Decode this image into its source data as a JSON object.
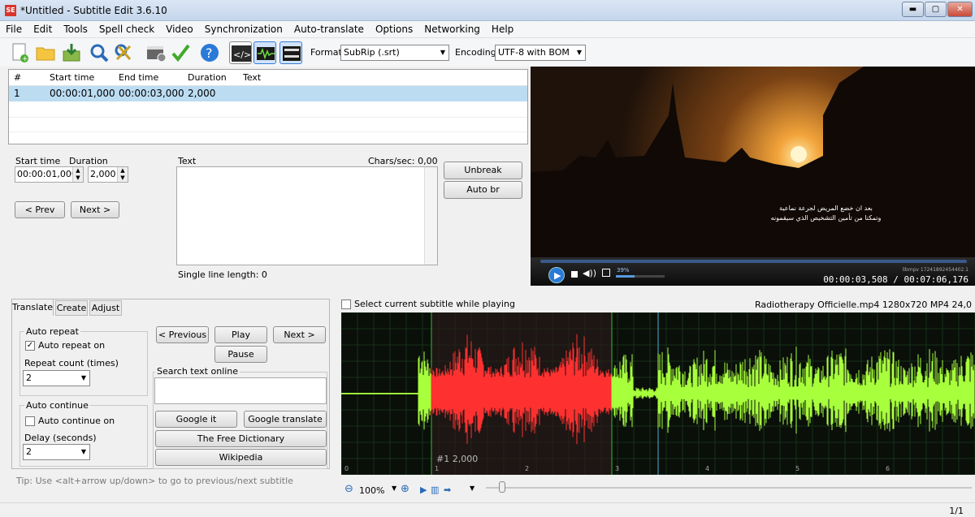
{
  "window": {
    "title": "*Untitled - Subtitle Edit 3.6.10",
    "icon": "SE"
  },
  "menu": [
    "File",
    "Edit",
    "Tools",
    "Spell check",
    "Video",
    "Synchronization",
    "Auto-translate",
    "Options",
    "Networking",
    "Help"
  ],
  "toolbar": {
    "format_label": "Format",
    "format_value": "SubRip (.srt)",
    "encoding_label": "Encoding",
    "encoding_value": "UTF-8 with BOM"
  },
  "subtitle_grid": {
    "columns": [
      "#",
      "Start time",
      "End time",
      "Duration",
      "Text"
    ],
    "rows": [
      {
        "num": "1",
        "start": "00:00:01,000",
        "end": "00:00:03,000",
        "duration": "2,000",
        "text": ""
      }
    ]
  },
  "editor": {
    "start_time_label": "Start time",
    "duration_label": "Duration",
    "text_label": "Text",
    "chars_sec": "Chars/sec: 0,00",
    "start_time_value": "00:00:01,000",
    "duration_value": "2,000",
    "prev_button": "< Prev",
    "next_button": "Next >",
    "unbreak_button": "Unbreak",
    "auto_br_button": "Auto br",
    "single_line_length": "Single line length: 0"
  },
  "video": {
    "subtitle_line1": "بعد ان خضع المريض لجرعة نماعية",
    "subtitle_line2": "وتمكنا من تأمين التشخيص الذي سيقمونه",
    "volume": "39%",
    "player_info": "libmpv 17241892454402.1",
    "time": "00:00:03,508 / 00:07:06,176",
    "volume_level": 0.39
  },
  "tabs": [
    "Translate",
    "Create",
    "Adjust"
  ],
  "translate": {
    "auto_repeat_title": "Auto repeat",
    "auto_repeat_on": "Auto repeat on",
    "repeat_count_label": "Repeat count (times)",
    "repeat_count_value": "2",
    "auto_continue_title": "Auto continue",
    "auto_continue_on": "Auto continue on",
    "delay_label": "Delay (seconds)",
    "delay_value": "2",
    "previous_button": "< Previous",
    "play_button": "Play",
    "next_button": "Next >",
    "pause_button": "Pause",
    "search_label": "Search text online",
    "google_it": "Google it",
    "google_translate": "Google translate",
    "free_dictionary": "The Free Dictionary",
    "wikipedia": "Wikipedia",
    "tip": "Tip: Use <alt+arrow up/down> to go to previous/next subtitle"
  },
  "waveform": {
    "select_current_label": "Select current subtitle while playing",
    "file_info": "Radiotherapy Officielle.mp4 1280x720 MP4 24,0",
    "subtitle_marker": "#1  2,000",
    "seconds": [
      "0",
      "1",
      "2",
      "3",
      "4",
      "5",
      "6"
    ],
    "zoom": "100%",
    "colors": {
      "selected": "#ff3030",
      "wave": "#a8ff3c",
      "background": "#0a0f0a"
    }
  },
  "status": {
    "page": "1/1"
  }
}
